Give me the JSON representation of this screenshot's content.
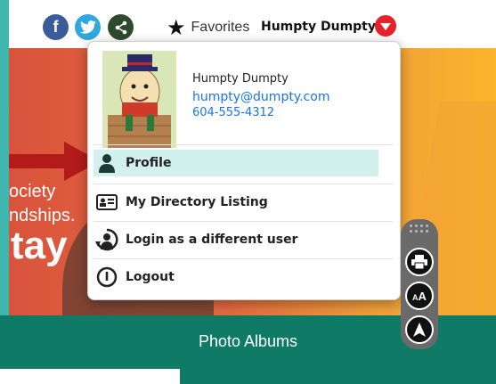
{
  "social": {
    "facebook_glyph": "f",
    "twitter_icon": "twitter-bird-icon",
    "share_icon": "share-icon"
  },
  "header": {
    "favorites_label": "Favorites",
    "user_name": "Humpty Dumpty"
  },
  "hero": {
    "line1": "ociety",
    "line2": "ndships.",
    "line3": "tay"
  },
  "band": {
    "label": "Photo Albums"
  },
  "dropdown": {
    "name": "Humpty Dumpty",
    "email": "humpty@dumpty.com",
    "phone": "604-555-4312",
    "items": [
      {
        "label": "Profile",
        "icon": "user-silhouette-icon"
      },
      {
        "label": "My Directory Listing",
        "icon": "id-card-icon"
      },
      {
        "label": "Login as a different user",
        "icon": "switch-user-icon"
      },
      {
        "label": "Logout",
        "icon": "power-icon"
      }
    ]
  },
  "tools": {
    "text_size_label": "A"
  },
  "colors": {
    "accent_teal": "#0f7a66",
    "left_strip": "#3fb7ae",
    "active_item_bg": "#d2f1ee",
    "link_blue": "#1a73e8",
    "dropdown_red": "#e8202a"
  }
}
